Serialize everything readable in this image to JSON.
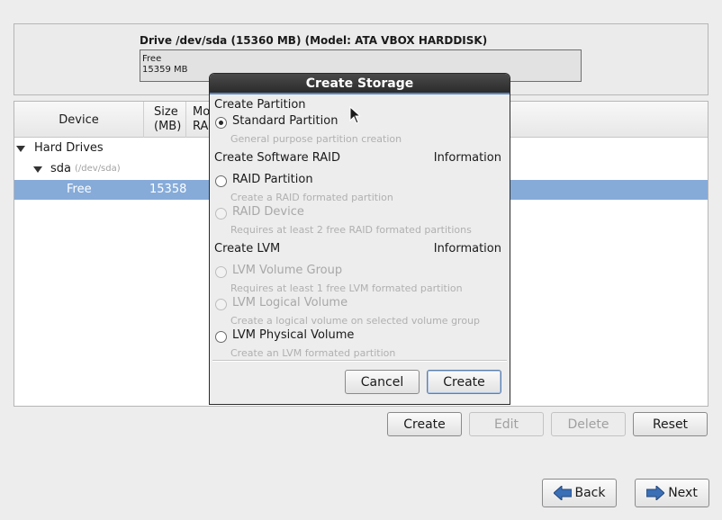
{
  "drive": {
    "title": "Drive /dev/sda (15360 MB) (Model: ATA VBOX HARDDISK)",
    "bar_line1": "Free",
    "bar_line2": "15359 MB"
  },
  "tree": {
    "headers": {
      "device": "Device",
      "size_line1": "Size",
      "size_line2": "(MB)",
      "mount_line1": "Mo",
      "mount_line2": "RA"
    },
    "rows": {
      "hard_drives": "Hard Drives",
      "sda": "sda",
      "sda_path": "(/dev/sda)",
      "free": "Free",
      "free_size": "15358"
    }
  },
  "actions": {
    "create": "Create",
    "edit": "Edit",
    "delete": "Delete",
    "reset": "Reset"
  },
  "nav": {
    "back": "Back",
    "next": "Next"
  },
  "dialog": {
    "title": "Create Storage",
    "section_partition": "Create Partition",
    "standard_partition": "Standard Partition",
    "standard_partition_desc": "General purpose partition creation",
    "section_raid": "Create Software RAID",
    "raid_info": "Information",
    "raid_partition": "RAID Partition",
    "raid_partition_desc": "Create a RAID formated partition",
    "raid_device": "RAID Device",
    "raid_device_desc": "Requires at least 2 free RAID formated partitions",
    "section_lvm": "Create LVM",
    "lvm_info": "Information",
    "lvm_volume_group": "LVM Volume Group",
    "lvm_volume_group_desc": "Requires at least 1 free LVM formated partition",
    "lvm_logical_volume": "LVM Logical Volume",
    "lvm_logical_volume_desc": "Create a logical volume on selected volume group",
    "lvm_physical_volume": "LVM Physical Volume",
    "lvm_physical_volume_desc": "Create an LVM formated partition",
    "cancel": "Cancel",
    "create": "Create"
  },
  "colors": {
    "selection": "#86abd9",
    "titlebar": "#2b2b2b",
    "arrow": "#3b6fb6"
  },
  "icons": {
    "back": "arrow-left-icon",
    "next": "arrow-right-icon",
    "expander": "triangle-down-icon",
    "pointer": "mouse-cursor-icon"
  }
}
